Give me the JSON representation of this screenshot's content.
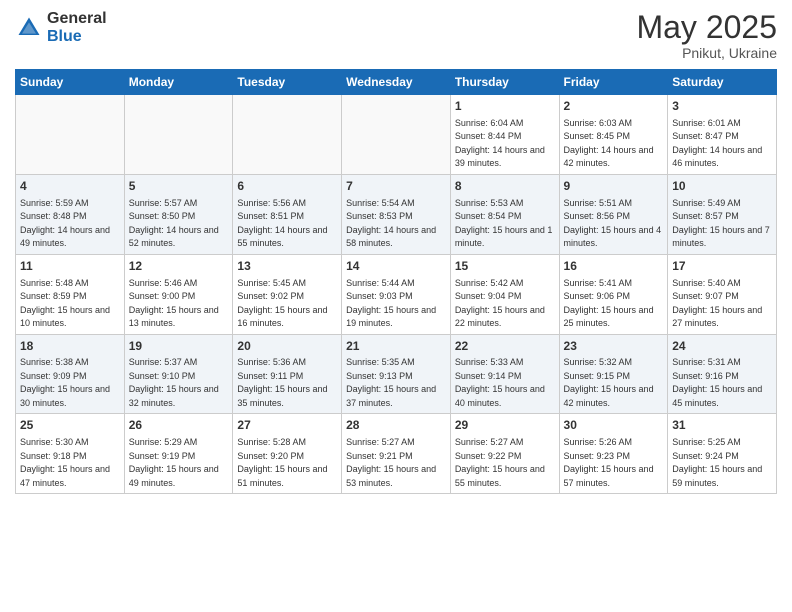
{
  "logo": {
    "general": "General",
    "blue": "Blue"
  },
  "title": "May 2025",
  "location": "Pnikut, Ukraine",
  "days_header": [
    "Sunday",
    "Monday",
    "Tuesday",
    "Wednesday",
    "Thursday",
    "Friday",
    "Saturday"
  ],
  "weeks": [
    [
      {
        "num": "",
        "empty": true
      },
      {
        "num": "",
        "empty": true
      },
      {
        "num": "",
        "empty": true
      },
      {
        "num": "",
        "empty": true
      },
      {
        "num": "1",
        "sunrise": "6:04 AM",
        "sunset": "8:44 PM",
        "daylight": "14 hours and 39 minutes."
      },
      {
        "num": "2",
        "sunrise": "6:03 AM",
        "sunset": "8:45 PM",
        "daylight": "14 hours and 42 minutes."
      },
      {
        "num": "3",
        "sunrise": "6:01 AM",
        "sunset": "8:47 PM",
        "daylight": "14 hours and 46 minutes."
      }
    ],
    [
      {
        "num": "4",
        "sunrise": "5:59 AM",
        "sunset": "8:48 PM",
        "daylight": "14 hours and 49 minutes."
      },
      {
        "num": "5",
        "sunrise": "5:57 AM",
        "sunset": "8:50 PM",
        "daylight": "14 hours and 52 minutes."
      },
      {
        "num": "6",
        "sunrise": "5:56 AM",
        "sunset": "8:51 PM",
        "daylight": "14 hours and 55 minutes."
      },
      {
        "num": "7",
        "sunrise": "5:54 AM",
        "sunset": "8:53 PM",
        "daylight": "14 hours and 58 minutes."
      },
      {
        "num": "8",
        "sunrise": "5:53 AM",
        "sunset": "8:54 PM",
        "daylight": "15 hours and 1 minute."
      },
      {
        "num": "9",
        "sunrise": "5:51 AM",
        "sunset": "8:56 PM",
        "daylight": "15 hours and 4 minutes."
      },
      {
        "num": "10",
        "sunrise": "5:49 AM",
        "sunset": "8:57 PM",
        "daylight": "15 hours and 7 minutes."
      }
    ],
    [
      {
        "num": "11",
        "sunrise": "5:48 AM",
        "sunset": "8:59 PM",
        "daylight": "15 hours and 10 minutes."
      },
      {
        "num": "12",
        "sunrise": "5:46 AM",
        "sunset": "9:00 PM",
        "daylight": "15 hours and 13 minutes."
      },
      {
        "num": "13",
        "sunrise": "5:45 AM",
        "sunset": "9:02 PM",
        "daylight": "15 hours and 16 minutes."
      },
      {
        "num": "14",
        "sunrise": "5:44 AM",
        "sunset": "9:03 PM",
        "daylight": "15 hours and 19 minutes."
      },
      {
        "num": "15",
        "sunrise": "5:42 AM",
        "sunset": "9:04 PM",
        "daylight": "15 hours and 22 minutes."
      },
      {
        "num": "16",
        "sunrise": "5:41 AM",
        "sunset": "9:06 PM",
        "daylight": "15 hours and 25 minutes."
      },
      {
        "num": "17",
        "sunrise": "5:40 AM",
        "sunset": "9:07 PM",
        "daylight": "15 hours and 27 minutes."
      }
    ],
    [
      {
        "num": "18",
        "sunrise": "5:38 AM",
        "sunset": "9:09 PM",
        "daylight": "15 hours and 30 minutes."
      },
      {
        "num": "19",
        "sunrise": "5:37 AM",
        "sunset": "9:10 PM",
        "daylight": "15 hours and 32 minutes."
      },
      {
        "num": "20",
        "sunrise": "5:36 AM",
        "sunset": "9:11 PM",
        "daylight": "15 hours and 35 minutes."
      },
      {
        "num": "21",
        "sunrise": "5:35 AM",
        "sunset": "9:13 PM",
        "daylight": "15 hours and 37 minutes."
      },
      {
        "num": "22",
        "sunrise": "5:33 AM",
        "sunset": "9:14 PM",
        "daylight": "15 hours and 40 minutes."
      },
      {
        "num": "23",
        "sunrise": "5:32 AM",
        "sunset": "9:15 PM",
        "daylight": "15 hours and 42 minutes."
      },
      {
        "num": "24",
        "sunrise": "5:31 AM",
        "sunset": "9:16 PM",
        "daylight": "15 hours and 45 minutes."
      }
    ],
    [
      {
        "num": "25",
        "sunrise": "5:30 AM",
        "sunset": "9:18 PM",
        "daylight": "15 hours and 47 minutes."
      },
      {
        "num": "26",
        "sunrise": "5:29 AM",
        "sunset": "9:19 PM",
        "daylight": "15 hours and 49 minutes."
      },
      {
        "num": "27",
        "sunrise": "5:28 AM",
        "sunset": "9:20 PM",
        "daylight": "15 hours and 51 minutes."
      },
      {
        "num": "28",
        "sunrise": "5:27 AM",
        "sunset": "9:21 PM",
        "daylight": "15 hours and 53 minutes."
      },
      {
        "num": "29",
        "sunrise": "5:27 AM",
        "sunset": "9:22 PM",
        "daylight": "15 hours and 55 minutes."
      },
      {
        "num": "30",
        "sunrise": "5:26 AM",
        "sunset": "9:23 PM",
        "daylight": "15 hours and 57 minutes."
      },
      {
        "num": "31",
        "sunrise": "5:25 AM",
        "sunset": "9:24 PM",
        "daylight": "15 hours and 59 minutes."
      }
    ]
  ]
}
